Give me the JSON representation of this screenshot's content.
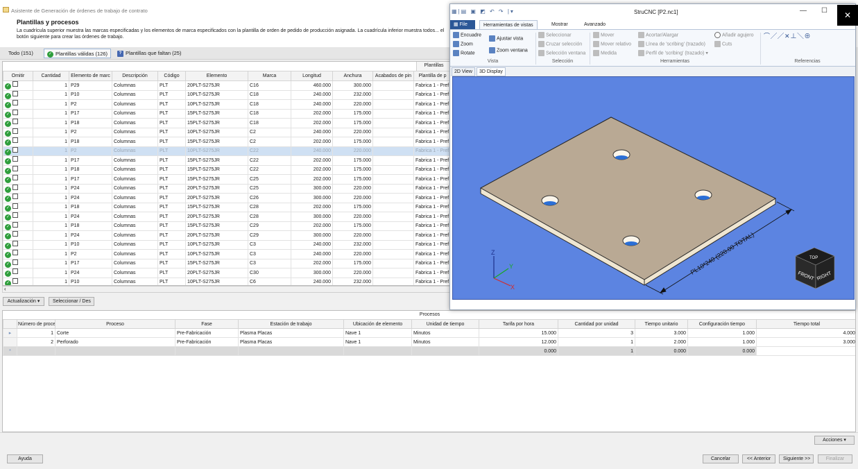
{
  "wizard": {
    "title": "Asistente de Generación de órdenes de trabajo de contrato",
    "section_title": "Plantillas y procesos",
    "description": "La cuadrícula superior muestra las marcas especificadas y los elementos de marca especificados con la plantilla de orden de pedido de producción asignada. La cuadrícula inferior muestra todos... el botón siguiente para crear las órdenes de trabajo.",
    "filter_tabs": [
      {
        "label": "Todo (151)"
      },
      {
        "label": "Plantillas válidas (126)"
      },
      {
        "label": "Plantillas que faltan (25)"
      }
    ],
    "plantillas_header": "Plantillas",
    "columns": [
      "Omitir",
      "Cantidad",
      "Elemento de marc",
      "Descripción",
      "Código",
      "Elemento",
      "Marca",
      "Longitud",
      "Anchura",
      "Acabados de pin",
      "Plantilla de p"
    ],
    "rows": [
      {
        "qty": "1",
        "el": "P29",
        "desc": "Columnas",
        "code": "PLT",
        "elem": "20PLT-S275JR",
        "mark": "C16",
        "len": "460.000",
        "wid": "300.000",
        "fin": "",
        "tpl": "Fabrica 1 - Pref"
      },
      {
        "qty": "1",
        "el": "P10",
        "desc": "Columnas",
        "code": "PLT",
        "elem": "10PLT-S275JR",
        "mark": "C18",
        "len": "240.000",
        "wid": "232.000",
        "fin": "",
        "tpl": "Fabrica 1 - Pref"
      },
      {
        "qty": "1",
        "el": "P2",
        "desc": "Columnas",
        "code": "PLT",
        "elem": "10PLT-S275JR",
        "mark": "C18",
        "len": "240.000",
        "wid": "220.000",
        "fin": "",
        "tpl": "Fabrica 1 - Pref"
      },
      {
        "qty": "1",
        "el": "P17",
        "desc": "Columnas",
        "code": "PLT",
        "elem": "15PLT-S275JR",
        "mark": "C18",
        "len": "202.000",
        "wid": "175.000",
        "fin": "",
        "tpl": "Fabrica 1 - Pref"
      },
      {
        "qty": "1",
        "el": "P18",
        "desc": "Columnas",
        "code": "PLT",
        "elem": "15PLT-S275JR",
        "mark": "C18",
        "len": "202.000",
        "wid": "175.000",
        "fin": "",
        "tpl": "Fabrica 1 - Pref"
      },
      {
        "qty": "1",
        "el": "P2",
        "desc": "Columnas",
        "code": "PLT",
        "elem": "10PLT-S275JR",
        "mark": "C2",
        "len": "240.000",
        "wid": "220.000",
        "fin": "",
        "tpl": "Fabrica 1 - Pref"
      },
      {
        "qty": "1",
        "el": "P18",
        "desc": "Columnas",
        "code": "PLT",
        "elem": "15PLT-S275JR",
        "mark": "C2",
        "len": "202.000",
        "wid": "175.000",
        "fin": "",
        "tpl": "Fabrica 1 - Pref"
      },
      {
        "qty": "1",
        "el": "P2",
        "desc": "Columnas",
        "code": "PLT",
        "elem": "10PLT-S275JR",
        "mark": "C22",
        "len": "240.000",
        "wid": "220.000",
        "fin": "",
        "tpl": "Fabrica 1 - Pref",
        "selected": true
      },
      {
        "qty": "1",
        "el": "P17",
        "desc": "Columnas",
        "code": "PLT",
        "elem": "15PLT-S275JR",
        "mark": "C22",
        "len": "202.000",
        "wid": "175.000",
        "fin": "",
        "tpl": "Fabrica 1 - Pref"
      },
      {
        "qty": "1",
        "el": "P18",
        "desc": "Columnas",
        "code": "PLT",
        "elem": "15PLT-S275JR",
        "mark": "C22",
        "len": "202.000",
        "wid": "175.000",
        "fin": "",
        "tpl": "Fabrica 1 - Pref"
      },
      {
        "qty": "1",
        "el": "P17",
        "desc": "Columnas",
        "code": "PLT",
        "elem": "15PLT-S275JR",
        "mark": "C25",
        "len": "202.000",
        "wid": "175.000",
        "fin": "",
        "tpl": "Fabrica 1 - Pref"
      },
      {
        "qty": "1",
        "el": "P24",
        "desc": "Columnas",
        "code": "PLT",
        "elem": "20PLT-S275JR",
        "mark": "C25",
        "len": "300.000",
        "wid": "220.000",
        "fin": "",
        "tpl": "Fabrica 1 - Pref"
      },
      {
        "qty": "1",
        "el": "P24",
        "desc": "Columnas",
        "code": "PLT",
        "elem": "20PLT-S275JR",
        "mark": "C26",
        "len": "300.000",
        "wid": "220.000",
        "fin": "",
        "tpl": "Fabrica 1 - Pref"
      },
      {
        "qty": "1",
        "el": "P18",
        "desc": "Columnas",
        "code": "PLT",
        "elem": "15PLT-S275JR",
        "mark": "C28",
        "len": "202.000",
        "wid": "175.000",
        "fin": "",
        "tpl": "Fabrica 1 - Pref"
      },
      {
        "qty": "1",
        "el": "P24",
        "desc": "Columnas",
        "code": "PLT",
        "elem": "20PLT-S275JR",
        "mark": "C28",
        "len": "300.000",
        "wid": "220.000",
        "fin": "",
        "tpl": "Fabrica 1 - Pref"
      },
      {
        "qty": "1",
        "el": "P18",
        "desc": "Columnas",
        "code": "PLT",
        "elem": "15PLT-S275JR",
        "mark": "C29",
        "len": "202.000",
        "wid": "175.000",
        "fin": "",
        "tpl": "Fabrica 1 - Pref"
      },
      {
        "qty": "1",
        "el": "P24",
        "desc": "Columnas",
        "code": "PLT",
        "elem": "20PLT-S275JR",
        "mark": "C29",
        "len": "300.000",
        "wid": "220.000",
        "fin": "",
        "tpl": "Fabrica 1 - Pref"
      },
      {
        "qty": "1",
        "el": "P10",
        "desc": "Columnas",
        "code": "PLT",
        "elem": "10PLT-S275JR",
        "mark": "C3",
        "len": "240.000",
        "wid": "232.000",
        "fin": "",
        "tpl": "Fabrica 1 - Pref"
      },
      {
        "qty": "1",
        "el": "P2",
        "desc": "Columnas",
        "code": "PLT",
        "elem": "10PLT-S275JR",
        "mark": "C3",
        "len": "240.000",
        "wid": "220.000",
        "fin": "",
        "tpl": "Fabrica 1 - Pref"
      },
      {
        "qty": "1",
        "el": "P17",
        "desc": "Columnas",
        "code": "PLT",
        "elem": "15PLT-S275JR",
        "mark": "C3",
        "len": "202.000",
        "wid": "175.000",
        "fin": "",
        "tpl": "Fabrica 1 - Pref"
      },
      {
        "qty": "1",
        "el": "P24",
        "desc": "Columnas",
        "code": "PLT",
        "elem": "20PLT-S275JR",
        "mark": "C30",
        "len": "300.000",
        "wid": "220.000",
        "fin": "",
        "tpl": "Fabrica 1 - Pref"
      },
      {
        "qty": "1",
        "el": "P10",
        "desc": "Columnas",
        "code": "PLT",
        "elem": "10PLT-S275JR",
        "mark": "C6",
        "len": "240.000",
        "wid": "232.000",
        "fin": "",
        "tpl": "Fabrica 1 - Pref"
      }
    ],
    "update_button": "Actualización",
    "select_button": "Seleccionar / Des",
    "processes": {
      "header": "Procesos",
      "columns": [
        "Número de proceso",
        "Proceso",
        "Fase",
        "Estación de trabajo",
        "Ubicación de elemento",
        "Unidad de tiempo",
        "Tarifa por hora",
        "Cantidad por unidad",
        "Tiempo unitario",
        "Configuración tiempo",
        "Tiempo total"
      ],
      "rows": [
        {
          "num": "1",
          "proc": "Corte",
          "phase": "Pre-Fabricación",
          "station": "Plasma Placas",
          "loc": "Nave 1",
          "unit": "Minutos",
          "rate": "15.000",
          "qty": "3",
          "unit_time": "3.000",
          "setup": "1.000",
          "total": "4.000"
        },
        {
          "num": "2",
          "proc": "Perforado",
          "phase": "Pre-Fabricación",
          "station": "Plasma Placas",
          "loc": "Nave 1",
          "unit": "Minutos",
          "rate": "12.000",
          "qty": "1",
          "unit_time": "2.000",
          "setup": "1.000",
          "total": "3.000"
        }
      ],
      "new_row": {
        "rate": "0.000",
        "qty": "1",
        "unit_time": "0.000",
        "setup": "0.000"
      }
    },
    "actions_button": "Acciones",
    "help_button": "Ayuda",
    "cancel_button": "Cancelar",
    "back_button": "<< Anterior",
    "next_button": "Siguiente >>",
    "finish_button": "Finalizar"
  },
  "cnc": {
    "title": "StruCNC [P2.nc1]",
    "tabs": [
      "File",
      "Herramientas de vistas",
      "Mostrar",
      "Avanzado"
    ],
    "ribbon": {
      "encuadre": "Encuadre",
      "zoom": "Zoom",
      "rotate": "Rotate",
      "ajustar_vista": "Ajustar vista",
      "zoom_ventana": "Zoom ventana",
      "seleccionar": "Seleccionar",
      "cruzar": "Cruzar selección",
      "sel_ventana": "Selección ventana",
      "mover": "Mover",
      "mover_rel": "Mover relativo",
      "medida": "Medida",
      "acortar": "Acortar/Alargar",
      "linea_scribing": "Línea de 'scribing' (trazado)",
      "perfil_scribing": "Perfil de 'scribing' (trazado)",
      "anadir_agujero": "Añadir agujero",
      "cuts": "Cuts",
      "groups": [
        "Vista",
        "Selección",
        "Herramientas",
        "Referencias"
      ]
    },
    "view_tabs": [
      "2D View",
      "3D Display"
    ],
    "dimension_text": "PL10*240 (220.00 TOTAL)",
    "cube": {
      "top": "TOP",
      "front": "FRONT",
      "right": "RIGHT"
    },
    "axes": {
      "x": "X",
      "y": "Y",
      "z": "Z"
    },
    "colors": {
      "viewport": "#5c84e1",
      "plate_top": "#b9a994",
      "plate_edge": "#efe6d2",
      "file_tab": "#2b5797"
    }
  }
}
